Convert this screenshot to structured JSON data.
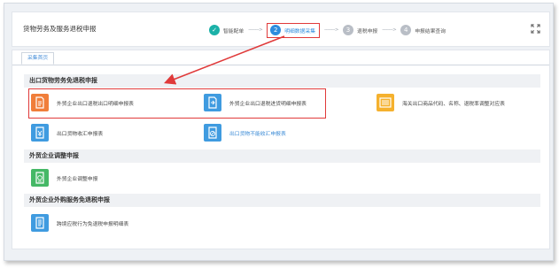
{
  "header": {
    "title": "货物劳务及服务退税申报",
    "steps": [
      {
        "label": "智能配单",
        "status": "done",
        "marker": "✓"
      },
      {
        "label": "明细数据采集",
        "status": "active",
        "marker": "2"
      },
      {
        "label": "退税申报",
        "status": "todo",
        "marker": "3"
      },
      {
        "label": "申报结果查询",
        "status": "todo",
        "marker": "4"
      }
    ],
    "step_arrow": "-------->"
  },
  "tab": {
    "label": "采集首页"
  },
  "sections": [
    {
      "title": "出口货物劳务免退税申报",
      "items": [
        {
          "label": "外贸企业出口退税出口明细申报表",
          "icon": "export-detail-doc-icon",
          "color": "#f07e3a"
        },
        {
          "label": "外贸企业出口退税进货明细申报表",
          "icon": "purchase-detail-doc-icon",
          "color": "#3f9be0"
        },
        {
          "label": "海关出口商品代码、名称、退税率调整对应表",
          "icon": "customs-code-table-icon",
          "color": "#f5b12e"
        },
        {
          "label": "出口货物收汇申报表",
          "icon": "forex-receipt-doc-icon",
          "color": "#3f9be0"
        },
        {
          "label": "出口货物不能收汇申报表",
          "icon": "no-forex-receipt-doc-icon",
          "color": "#3f9be0",
          "link": true
        }
      ]
    },
    {
      "title": "外贸企业调整申报",
      "items": [
        {
          "label": "外贸企业调整申报",
          "icon": "adjustment-doc-icon",
          "color": "#45b866"
        }
      ]
    },
    {
      "title": "外贸企业外购服务免退税申报",
      "items": [
        {
          "label": "跨境应税行为免退税申报明细表",
          "icon": "cross-border-doc-icon",
          "color": "#3f9be0"
        }
      ]
    }
  ]
}
